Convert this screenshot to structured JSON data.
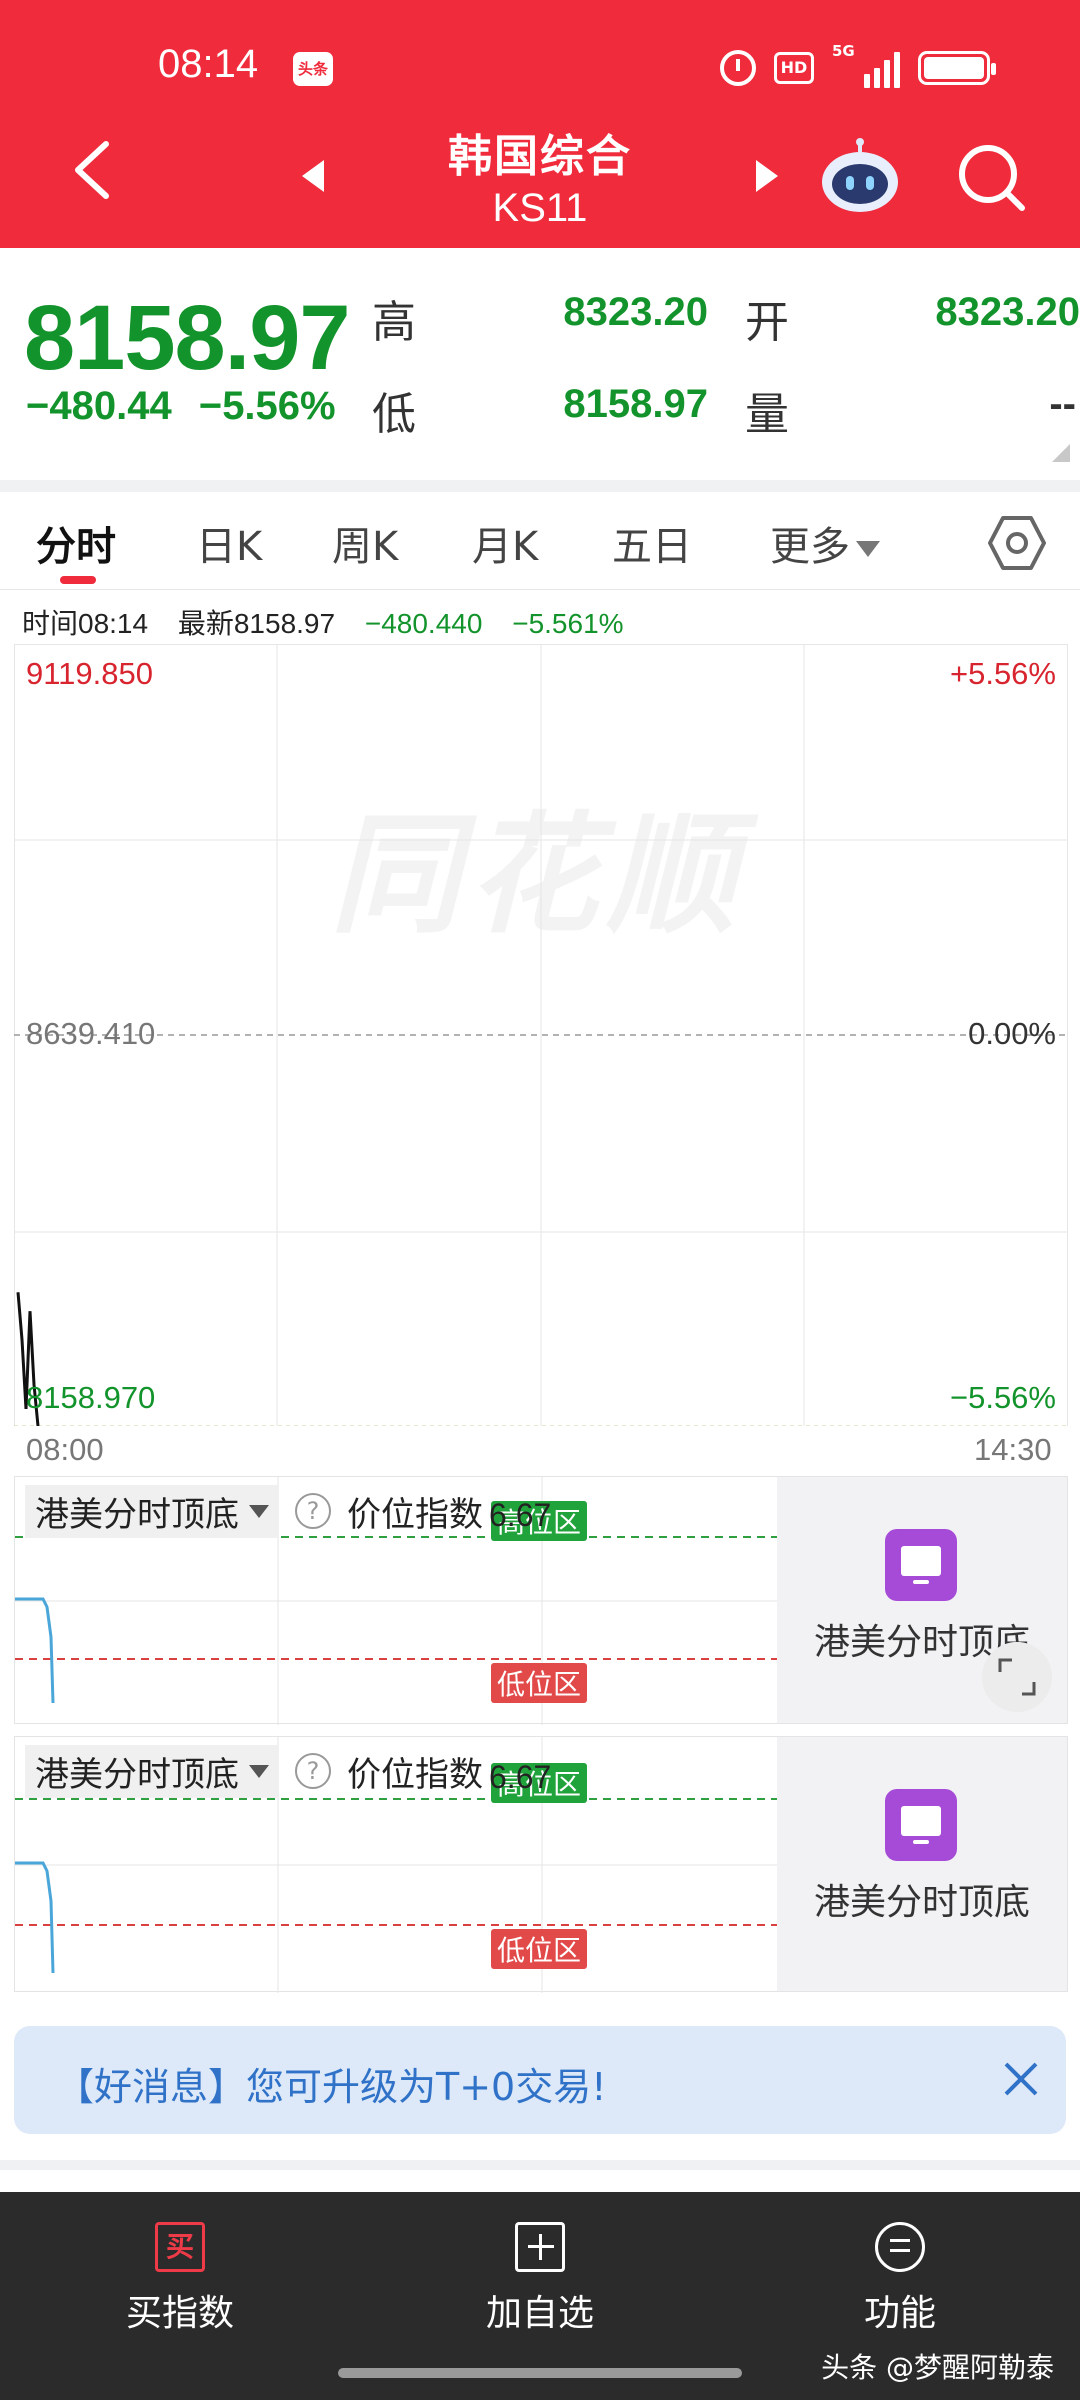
{
  "status": {
    "time": "08:14",
    "app_badge": "头条",
    "net_label": "5G",
    "hd_label": "HD"
  },
  "header": {
    "title": "韩国综合",
    "subtitle": "KS11"
  },
  "quote": {
    "price": "8158.97",
    "change": "−480.44",
    "change_pct": "−5.56%",
    "high_label": "高",
    "high": "8323.20",
    "open_label": "开",
    "open": "8323.20",
    "low_label": "低",
    "low": "8158.97",
    "volume_label": "量",
    "volume": "--"
  },
  "tabs": [
    {
      "label": "分时"
    },
    {
      "label": "日K"
    },
    {
      "label": "周K"
    },
    {
      "label": "月K"
    },
    {
      "label": "五日"
    },
    {
      "label": "更多"
    }
  ],
  "info": {
    "time": "时间08:14",
    "latest": "最新8158.97",
    "change": "−480.440",
    "change_pct": "−5.561%"
  },
  "chart_data": {
    "type": "line",
    "y_max": "9119.850",
    "y_mid": "8639.410",
    "y_min": "8158.970",
    "pct_max": "+5.56%",
    "pct_mid": "0.00%",
    "pct_min": "−5.56%",
    "x_start": "08:00",
    "x_end": "14:30",
    "ylim": [
      8158.97,
      9119.85
    ],
    "series": [
      {
        "values": [
          8323.2,
          8265.0,
          8180.0,
          8300.0,
          8210.0,
          8158.97
        ]
      }
    ],
    "watermark": "同花顺"
  },
  "indicators": [
    {
      "name": "港美分时顶底",
      "title": "价位指数",
      "value": "6.67",
      "high_zone": "高位区",
      "low_zone": "低位区",
      "side_label": "港美分时顶底"
    },
    {
      "name": "港美分时顶底",
      "title": "价位指数",
      "value": "6.67",
      "high_zone": "高位区",
      "low_zone": "低位区",
      "side_label": "港美分时顶底"
    }
  ],
  "promo": {
    "text": "【好消息】您可升级为T+0交易!"
  },
  "bottom_nav": [
    {
      "label": "买指数",
      "icon_text": "买"
    },
    {
      "label": "加自选"
    },
    {
      "label": "功能"
    }
  ],
  "credit": "头条 @梦醒阿勒泰",
  "colors": {
    "brand_red": "#ef2b3c",
    "down_green": "#13932b",
    "up_red": "#d8242f"
  },
  "icons": [
    "back-icon",
    "prev-arrow-icon",
    "next-arrow-icon",
    "robot-icon",
    "search-icon",
    "settings-icon",
    "help-icon",
    "monitor-icon",
    "expand-icon",
    "close-icon",
    "buy-icon",
    "add-icon",
    "menu-icon"
  ]
}
